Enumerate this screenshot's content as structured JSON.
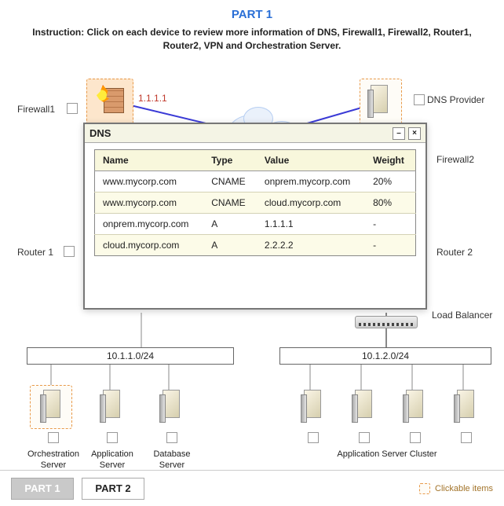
{
  "header": {
    "part_title": "PART 1",
    "instruction": "Instruction: Click on each device to review more information of DNS, Firewall1, Firewall2, Router1, Router2, VPN and Orchestration Server."
  },
  "labels": {
    "firewall1": "Firewall1",
    "firewall2": "Firewall2",
    "dns_provider": "DNS Provider",
    "router1": "Router 1",
    "router2": "Router 2",
    "load_balancer": "Load Balancer",
    "orchestration_server": "Orchestration\nServer",
    "application_server": "Application\nServer",
    "database_server": "Database\nServer",
    "application_server_cluster": "Application Server Cluster",
    "ip_fw1": "1.1.1.1"
  },
  "subnets": {
    "left": "10.1.1.0/24",
    "right": "10.1.2.0/24"
  },
  "dns_window": {
    "title": "DNS",
    "columns": {
      "name": "Name",
      "type": "Type",
      "value": "Value",
      "weight": "Weight"
    },
    "rows": [
      {
        "name": "www.mycorp.com",
        "type": "CNAME",
        "value": "onprem.mycorp.com",
        "weight": "20%"
      },
      {
        "name": "www.mycorp.com",
        "type": "CNAME",
        "value": "cloud.mycorp.com",
        "weight": "80%"
      },
      {
        "name": "onprem.mycorp.com",
        "type": "A",
        "value": "1.1.1.1",
        "weight": "-"
      },
      {
        "name": "cloud.mycorp.com",
        "type": "A",
        "value": "2.2.2.2",
        "weight": "-"
      }
    ]
  },
  "footer": {
    "part1": "PART 1",
    "part2": "PART 2",
    "legend": "Clickable items"
  }
}
